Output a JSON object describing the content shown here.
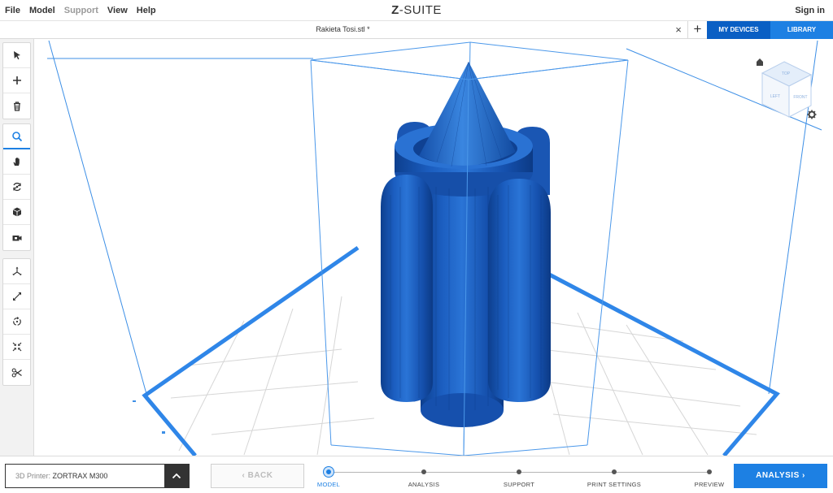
{
  "menu": {
    "items": [
      {
        "label": "File",
        "enabled": true
      },
      {
        "label": "Model",
        "enabled": true
      },
      {
        "label": "Support",
        "enabled": false
      },
      {
        "label": "View",
        "enabled": true
      },
      {
        "label": "Help",
        "enabled": true
      }
    ],
    "logo_mark": "Z",
    "logo_text": "-SUITE",
    "sign_in": "Sign in"
  },
  "tabs": {
    "file_tab": "Rakieta Tosi.stl *",
    "close_symbol": "×",
    "add_symbol": "+",
    "my_devices": "MY DEVICES",
    "library": "LIBRARY"
  },
  "toolbar": {
    "groups": [
      [
        "select-arrow-icon",
        "add-icon",
        "trash-icon"
      ],
      [
        "zoom-icon",
        "pan-hand-icon",
        "orbit-icon",
        "cube-view-icon",
        "camera-icon"
      ],
      [
        "move-icon",
        "scale-icon",
        "rotate-icon",
        "fit-icon",
        "cut-scissors-icon"
      ]
    ],
    "active_tool": "zoom-icon"
  },
  "viewcube": {
    "faces": {
      "top": "TOP",
      "left": "LEFT",
      "front": "FRONT"
    }
  },
  "bottom": {
    "printer_label": "3D Printer: ",
    "printer_value": "ZORTRAX M300",
    "back_label": "BACK",
    "steps": [
      {
        "label": "MODEL",
        "current": true
      },
      {
        "label": "ANALYSIS",
        "current": false
      },
      {
        "label": "SUPPORT",
        "current": false
      },
      {
        "label": "PRINT SETTINGS",
        "current": false
      },
      {
        "label": "PREVIEW",
        "current": false
      }
    ],
    "next_label": "ANALYSIS"
  },
  "colors": {
    "accent": "#1d80e3",
    "accent_dark": "#0a5fc4",
    "model_blue": "#1a5fc0",
    "bed_border": "#2f86e8"
  }
}
